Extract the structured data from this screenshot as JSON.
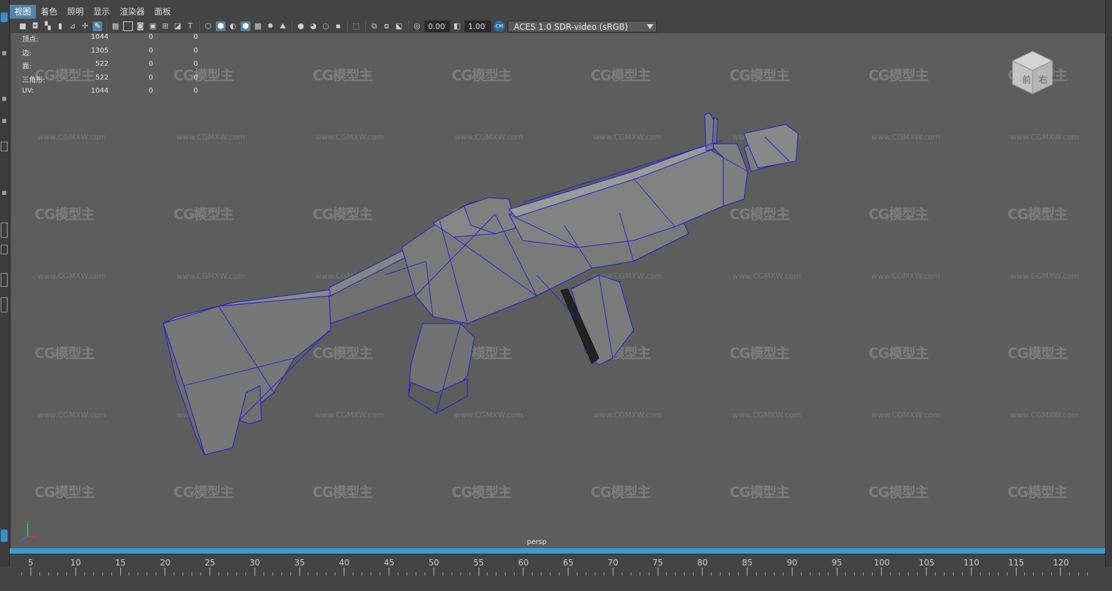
{
  "menubar": {
    "items": [
      "视图",
      "着色",
      "照明",
      "显示",
      "渲染器",
      "面板"
    ],
    "active_index": 0
  },
  "toolbar": {
    "exposure_value": "0.00",
    "gamma_value": "1.00",
    "color_space": "ACES 1.0 SDR-video (sRGB)"
  },
  "hud": {
    "rows": [
      {
        "label": "顶点:",
        "c1": "1044",
        "c2": "0",
        "c3": "0"
      },
      {
        "label": "边:",
        "c1": "1305",
        "c2": "0",
        "c3": "0"
      },
      {
        "label": "面:",
        "c1": "522",
        "c2": "0",
        "c3": "0"
      },
      {
        "label": "三角形:",
        "c1": "522",
        "c2": "0",
        "c3": "0"
      },
      {
        "label": "UV:",
        "c1": "1044",
        "c2": "0",
        "c3": "0"
      }
    ]
  },
  "viewport": {
    "camera": "persp",
    "background_color": "#5d5d5d",
    "wireframe_color": "#1c1cd0"
  },
  "view_cube": {
    "face_left": "前",
    "face_right": "右"
  },
  "watermark": {
    "logo_text": "CG模型主",
    "url_text": "www.CGMXW.com"
  },
  "timeline": {
    "labels": [
      "5",
      "10",
      "15",
      "20",
      "25",
      "30",
      "35",
      "40",
      "45",
      "50",
      "55",
      "60",
      "65",
      "70",
      "75",
      "80",
      "85",
      "90",
      "95",
      "100",
      "105",
      "110",
      "115",
      "120"
    ],
    "accent_color": "#3c9bd0"
  }
}
